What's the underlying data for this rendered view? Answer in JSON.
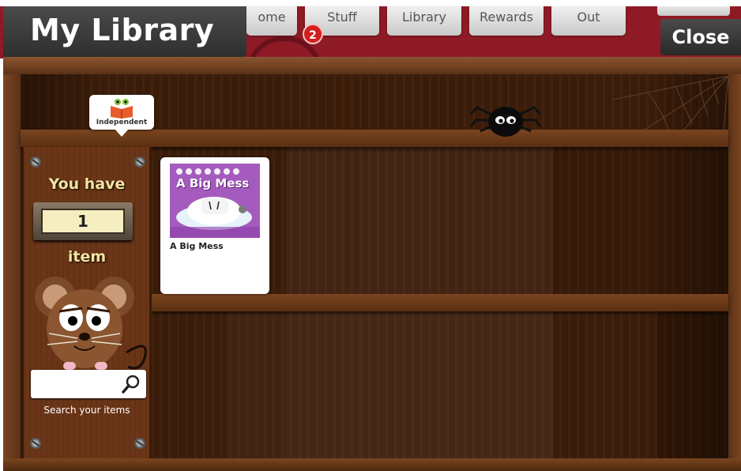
{
  "header": {
    "title": "My Library",
    "nav_tabs": [
      "Home",
      "Stuff",
      "Library",
      "Rewards",
      "Out"
    ],
    "nav_tabs_visible": [
      "ome",
      "Stuff",
      "Library",
      "Rewards",
      "Out"
    ],
    "notification_count": "2",
    "close_label": "Close"
  },
  "shelf": {
    "tag_label": "Independent",
    "books": [
      {
        "title": "A Big Mess",
        "cover_title": "A Big Mess",
        "cover_color": "#a45bbd"
      }
    ]
  },
  "side_panel": {
    "you_have_label": "You have",
    "item_count": "1",
    "item_label": "item",
    "search": {
      "value": "",
      "placeholder": ""
    },
    "search_caption": "Search your items"
  },
  "icons": {
    "search": "search-icon",
    "tag": "open-book-icon",
    "spider": "spider-icon",
    "mouse": "mouse-mascot-icon"
  },
  "colors": {
    "header_red": "#8e1a26",
    "panel_dark": "#3a3a3a",
    "badge_red": "#d11f1f",
    "wood": "#6a3a1c"
  }
}
